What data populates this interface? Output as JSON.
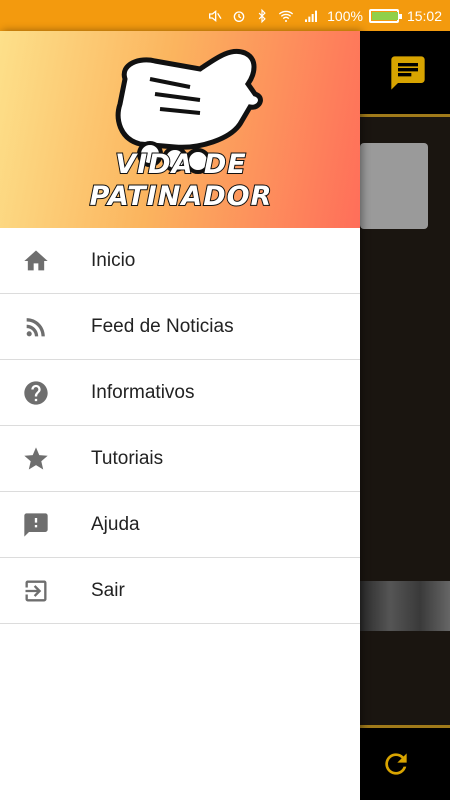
{
  "status_bar": {
    "battery_percent": "100%",
    "time": "15:02",
    "battery_level": 1.0,
    "battery_color": "#8fd04a",
    "background_color": "#f39a0e",
    "icons": [
      "mute-icon",
      "alarm-icon",
      "bluetooth-icon",
      "wifi-icon",
      "signal-icon",
      "battery-icon"
    ]
  },
  "drawer": {
    "logo_line1": "VIDA DE",
    "logo_line2": "PATINADOR",
    "items": [
      {
        "label": "Inicio",
        "icon": "home-icon"
      },
      {
        "label": "Feed de Noticias",
        "icon": "rss-icon"
      },
      {
        "label": "Informativos",
        "icon": "help-icon"
      },
      {
        "label": "Tutoriais",
        "icon": "star-icon"
      },
      {
        "label": "Ajuda",
        "icon": "feedback-icon"
      },
      {
        "label": "Sair",
        "icon": "exit-icon"
      }
    ]
  },
  "background_app": {
    "accent_color": "#e0a800",
    "top_icon": "chat-icon",
    "bottom_icon": "refresh-icon"
  }
}
